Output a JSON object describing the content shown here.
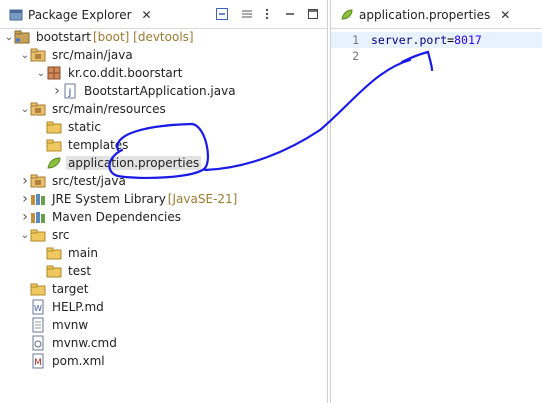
{
  "package_explorer": {
    "tab_title": "Package Explorer",
    "close_glyph": "✕",
    "toolbar": [
      "collapse-all-icon",
      "focus-icon",
      "view-menu-icon",
      "minimize-icon",
      "maximize-icon"
    ],
    "tree": [
      {
        "level": 0,
        "arrow": "down",
        "icon": "project-icon",
        "label": "bootstart",
        "decor": " [boot] [devtools]"
      },
      {
        "level": 1,
        "arrow": "down",
        "icon": "source-folder-icon",
        "label": "src/main/java"
      },
      {
        "level": 2,
        "arrow": "down",
        "icon": "package-icon",
        "label": "kr.co.ddit.boorstart"
      },
      {
        "level": 3,
        "arrow": "right",
        "icon": "java-file-icon",
        "label": "BootstartApplication.java"
      },
      {
        "level": 1,
        "arrow": "down",
        "icon": "source-folder-icon",
        "label": "src/main/resources"
      },
      {
        "level": 2,
        "arrow": "none",
        "icon": "folder-icon",
        "label": "static"
      },
      {
        "level": 2,
        "arrow": "none",
        "icon": "folder-icon",
        "label": "templates"
      },
      {
        "level": 2,
        "arrow": "none",
        "icon": "properties-file-icon",
        "label": "application.properties",
        "selected": true
      },
      {
        "level": 1,
        "arrow": "right",
        "icon": "source-folder-icon",
        "label": "src/test/java"
      },
      {
        "level": 1,
        "arrow": "right",
        "icon": "library-icon",
        "label": "JRE System Library",
        "decor": " [JavaSE-21]"
      },
      {
        "level": 1,
        "arrow": "right",
        "icon": "library-icon",
        "label": "Maven Dependencies"
      },
      {
        "level": 1,
        "arrow": "down",
        "icon": "folder-icon",
        "label": "src"
      },
      {
        "level": 2,
        "arrow": "none",
        "icon": "folder-icon",
        "label": "main"
      },
      {
        "level": 2,
        "arrow": "none",
        "icon": "folder-icon",
        "label": "test"
      },
      {
        "level": 1,
        "arrow": "none",
        "icon": "folder-icon",
        "label": "target"
      },
      {
        "level": 1,
        "arrow": "none",
        "icon": "markdown-file-icon",
        "label": "HELP.md"
      },
      {
        "level": 1,
        "arrow": "none",
        "icon": "text-file-icon",
        "label": "mvnw"
      },
      {
        "level": 1,
        "arrow": "none",
        "icon": "cmd-file-icon",
        "label": "mvnw.cmd"
      },
      {
        "level": 1,
        "arrow": "none",
        "icon": "maven-pom-icon",
        "label": "pom.xml"
      }
    ]
  },
  "editor": {
    "tab_title": "application.properties",
    "close_glyph": "✕",
    "lines": [
      {
        "num": "1",
        "key": "server.port",
        "eq": "=",
        "val": "8017"
      },
      {
        "num": "2",
        "key": "",
        "eq": "",
        "val": ""
      }
    ]
  },
  "colors": {
    "selection": "#e2e2e2",
    "current_line": "#e8f2fe",
    "annotation_ink": "#1a1ae6"
  }
}
